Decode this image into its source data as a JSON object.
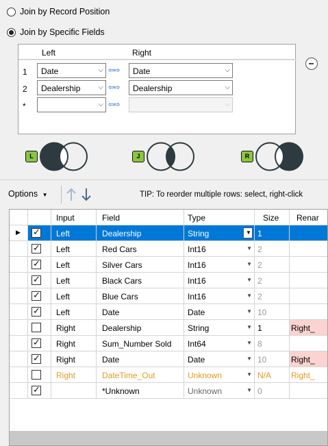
{
  "join_options": {
    "record_position": "Join by Record Position",
    "specific_fields": "Join by Specific Fields",
    "selected": "specific_fields"
  },
  "join_table": {
    "header_left": "Left",
    "header_right": "Right",
    "rows": [
      {
        "num": "1",
        "left": "Date",
        "right": "Date"
      },
      {
        "num": "2",
        "left": "Dealership",
        "right": "Dealership"
      },
      {
        "num": "*",
        "left": "",
        "right": ""
      }
    ]
  },
  "join_outputs": {
    "left": "L",
    "join": "J",
    "right": "R"
  },
  "toolbar": {
    "options_label": "Options",
    "tip": "TIP: To reorder multiple rows: select, right-click"
  },
  "grid": {
    "headers": {
      "input": "Input",
      "field": "Field",
      "type": "Type",
      "size": "Size",
      "rename": "Renar"
    },
    "rows": [
      {
        "checked": true,
        "input": "Left",
        "field": "Dealership",
        "type": "String",
        "size": "1",
        "rename": "",
        "selected": true
      },
      {
        "checked": true,
        "input": "Left",
        "field": "Red Cars",
        "type": "Int16",
        "size": "2",
        "rename": ""
      },
      {
        "checked": true,
        "input": "Left",
        "field": "Silver Cars",
        "type": "Int16",
        "size": "2",
        "rename": ""
      },
      {
        "checked": true,
        "input": "Left",
        "field": "Black Cars",
        "type": "Int16",
        "size": "2",
        "rename": ""
      },
      {
        "checked": true,
        "input": "Left",
        "field": "Blue Cars",
        "type": "Int16",
        "size": "2",
        "rename": ""
      },
      {
        "checked": true,
        "input": "Left",
        "field": "Date",
        "type": "Date",
        "size": "10",
        "rename": ""
      },
      {
        "checked": false,
        "input": "Right",
        "field": "Dealership",
        "type": "String",
        "size": "1",
        "rename": "Right_",
        "pink": true
      },
      {
        "checked": true,
        "input": "Right",
        "field": "Sum_Number Sold",
        "type": "Int64",
        "size": "8",
        "rename": ""
      },
      {
        "checked": true,
        "input": "Right",
        "field": "Date",
        "type": "Date",
        "size": "10",
        "rename": "Right_",
        "pink": true
      },
      {
        "checked": false,
        "input": "Right",
        "field": "DateTime_Out",
        "type": "Unknown",
        "size": "N/A",
        "rename": "Right_",
        "orange": true
      },
      {
        "checked": true,
        "input": "",
        "field": "*Unknown",
        "type": "Unknown",
        "size": "0",
        "rename": "",
        "gray": true
      }
    ]
  },
  "colors": {
    "selection": "#0078d7",
    "accent_orange": "#e39a1d",
    "rename_pink": "#fbd3d0",
    "venn_dark": "#2d3a40"
  }
}
